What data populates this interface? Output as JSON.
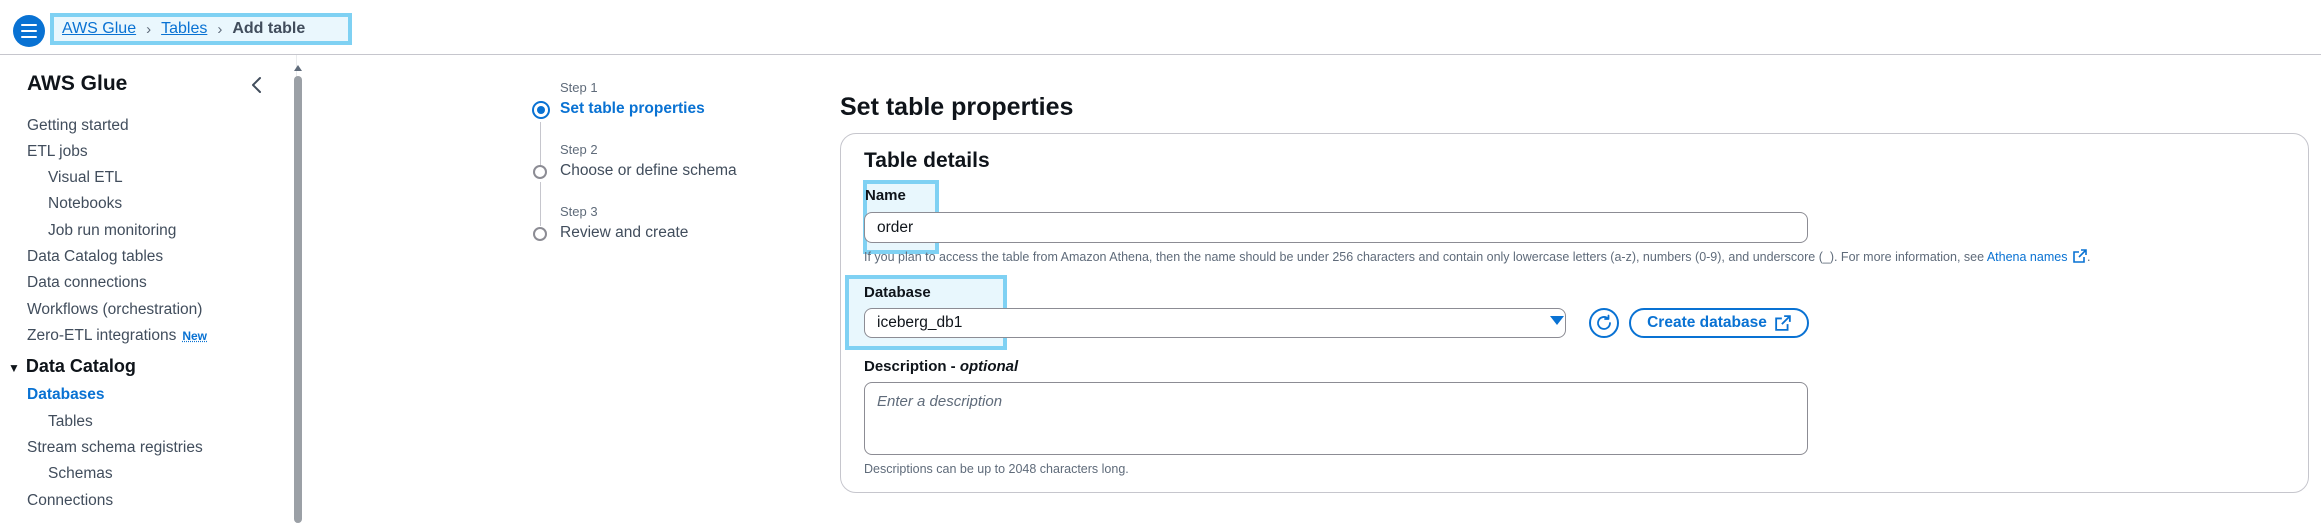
{
  "colors": {
    "accent": "#0972d3",
    "highlight": "#7fd1f3",
    "text": "#0f141a",
    "muted": "#5f6b7a"
  },
  "breadcrumb": {
    "items": [
      "AWS Glue",
      "Tables"
    ],
    "current": "Add table"
  },
  "sidebar": {
    "title": "AWS Glue",
    "items": {
      "getting_started": "Getting started",
      "etl_jobs": "ETL jobs",
      "visual_etl": "Visual ETL",
      "notebooks": "Notebooks",
      "job_run_monitoring": "Job run monitoring",
      "data_catalog_tables": "Data Catalog tables",
      "data_connections": "Data connections",
      "workflows": "Workflows (orchestration)",
      "zero_etl": "Zero-ETL integrations",
      "zero_etl_badge": "New",
      "section_data_catalog": "Data Catalog",
      "databases": "Databases",
      "tables": "Tables",
      "stream_schema_registries": "Stream schema registries",
      "schemas": "Schemas",
      "connections": "Connections"
    }
  },
  "steps": [
    {
      "label": "Step 1",
      "title": "Set table properties",
      "state": "active"
    },
    {
      "label": "Step 2",
      "title": "Choose or define schema",
      "state": "pending"
    },
    {
      "label": "Step 3",
      "title": "Review and create",
      "state": "pending"
    }
  ],
  "main": {
    "heading": "Set table properties",
    "container_title": "Table details",
    "name": {
      "label": "Name",
      "value": "order",
      "hint": "If you plan to access the table from Amazon Athena, then the name should be under 256 characters and contain only lowercase letters (a-z), numbers (0-9), and underscore (_). For more information, see",
      "hint_link": "Athena names",
      "hint_end": "."
    },
    "database": {
      "label": "Database",
      "value": "iceberg_db1",
      "create_button": "Create database"
    },
    "description": {
      "label": "Description",
      "label_suffix": "optional",
      "label_sep": " - ",
      "placeholder": "Enter a description",
      "hint": "Descriptions can be up to 2048 characters long."
    }
  }
}
